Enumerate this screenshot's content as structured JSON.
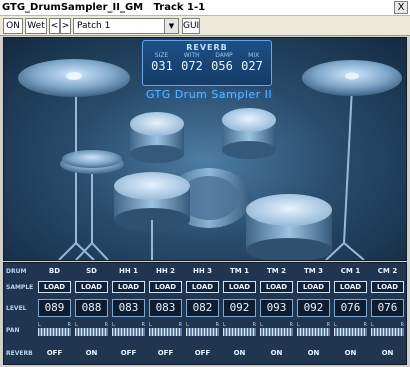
{
  "window": {
    "title": "GTG_DrumSampler_II_GM   Track 1-1",
    "close_label": "X"
  },
  "toolbar": {
    "on_label": "ON",
    "wet_label": "Wet",
    "prev_label": "<",
    "next_label": ">",
    "patch_value": "Patch   1",
    "gui_label": "GUI"
  },
  "reverb": {
    "title": "REVERB",
    "labels": [
      "SIZE",
      "WITH",
      "DAMP",
      "MIX"
    ],
    "values": [
      "031",
      "072",
      "056",
      "027"
    ]
  },
  "brand": "GTG Drum Sampler II",
  "mixer": {
    "row_labels": {
      "drum": "DRUM",
      "sample": "SAMPLE",
      "level": "LEVEL",
      "pan": "PAN",
      "reverb": "REVERB"
    },
    "channels": [
      {
        "name": "BD",
        "load": "LOAD",
        "level": "089",
        "pan_l": "L",
        "pan_r": "R",
        "reverb": "OFF"
      },
      {
        "name": "SD",
        "load": "LOAD",
        "level": "088",
        "pan_l": "L",
        "pan_r": "R",
        "reverb": "ON"
      },
      {
        "name": "HH 1",
        "load": "LOAD",
        "level": "083",
        "pan_l": "L",
        "pan_r": "R",
        "reverb": "OFF"
      },
      {
        "name": "HH 2",
        "load": "LOAD",
        "level": "083",
        "pan_l": "L",
        "pan_r": "R",
        "reverb": "OFF"
      },
      {
        "name": "HH 3",
        "load": "LOAD",
        "level": "082",
        "pan_l": "L",
        "pan_r": "R",
        "reverb": "OFF"
      },
      {
        "name": "TM 1",
        "load": "LOAD",
        "level": "092",
        "pan_l": "L",
        "pan_r": "R",
        "reverb": "ON"
      },
      {
        "name": "TM 2",
        "load": "LOAD",
        "level": "093",
        "pan_l": "L",
        "pan_r": "R",
        "reverb": "ON"
      },
      {
        "name": "TM 3",
        "load": "LOAD",
        "level": "092",
        "pan_l": "L",
        "pan_r": "R",
        "reverb": "ON"
      },
      {
        "name": "CM 1",
        "load": "LOAD",
        "level": "076",
        "pan_l": "L",
        "pan_r": "R",
        "reverb": "ON"
      },
      {
        "name": "CM 2",
        "load": "LOAD",
        "level": "076",
        "pan_l": "L",
        "pan_r": "R",
        "reverb": "ON"
      }
    ]
  },
  "colors": {
    "panel_bg": "#1f3550",
    "reverb_box": "#1d4f86",
    "brand_glow": "#5fb6ff"
  }
}
